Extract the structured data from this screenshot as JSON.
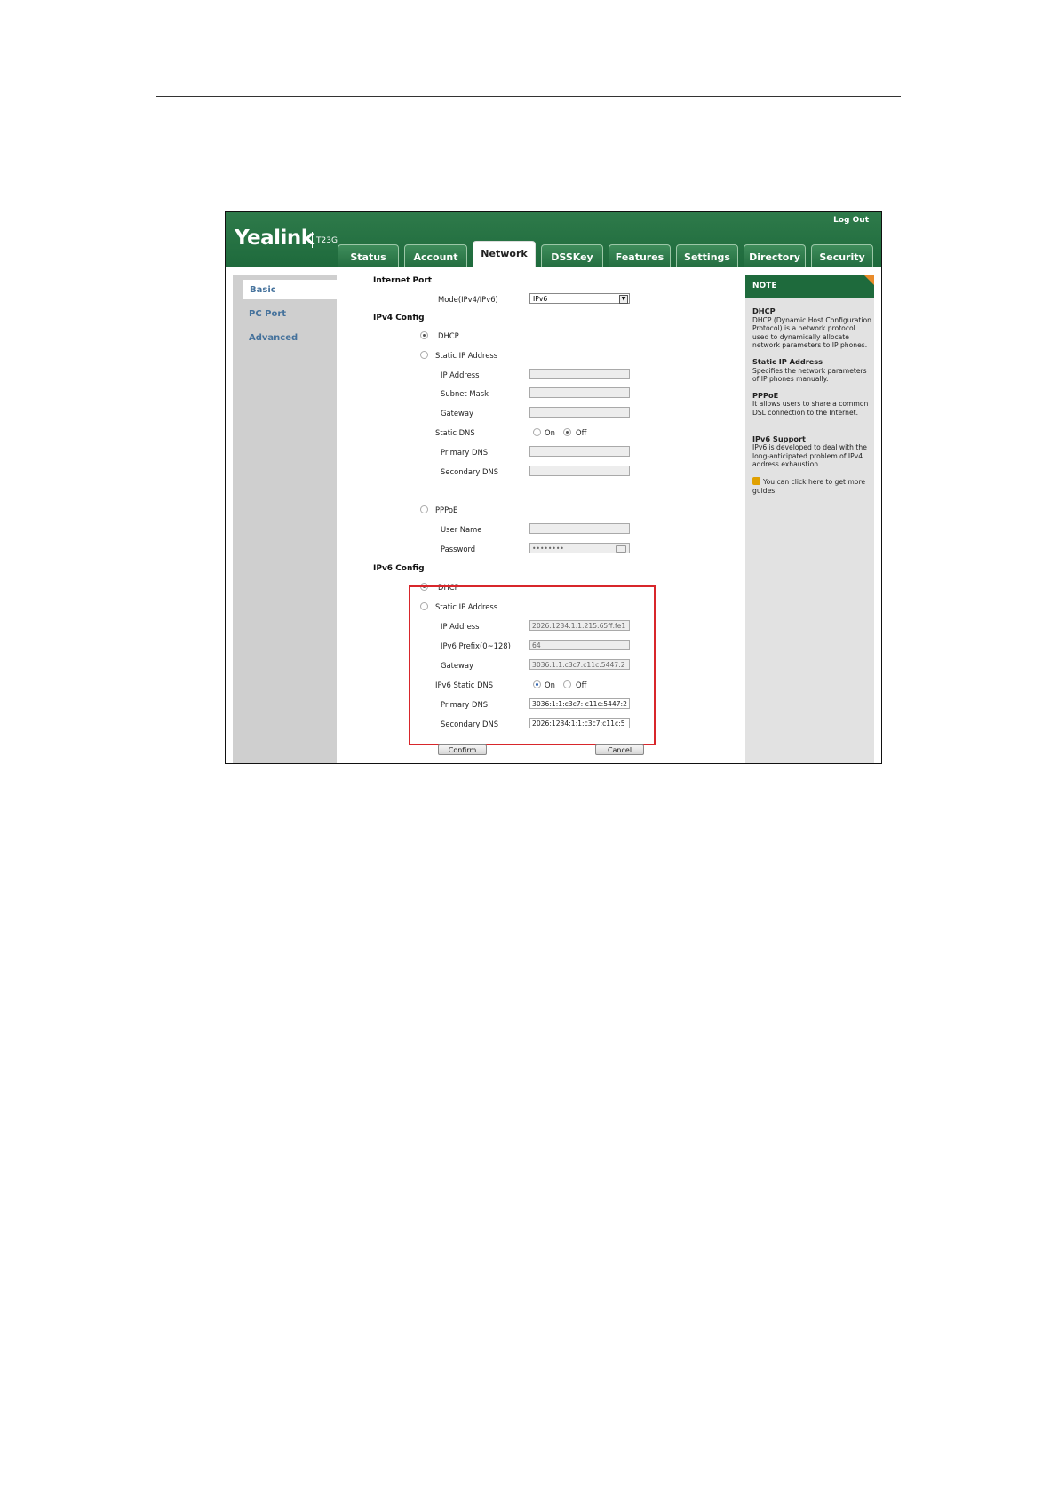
{
  "app": {
    "logo": "Yealink",
    "model": "T23G",
    "logout_label": "Log Out"
  },
  "tabs": [
    {
      "label": "Status"
    },
    {
      "label": "Account"
    },
    {
      "label": "Network",
      "active": true
    },
    {
      "label": "DSSKey"
    },
    {
      "label": "Features"
    },
    {
      "label": "Settings"
    },
    {
      "label": "Directory"
    },
    {
      "label": "Security"
    }
  ],
  "sidebar": {
    "items": [
      {
        "label": "Basic",
        "selected": true
      },
      {
        "label": "PC Port"
      },
      {
        "label": "Advanced"
      }
    ]
  },
  "main": {
    "internet_port_title": "Internet Port",
    "mode_label": "Mode(IPv4/IPv6)",
    "mode_value": "IPv6",
    "ipv4": {
      "title": "IPv4 Config",
      "dhcp_label": "DHCP",
      "static_label": "Static IP Address",
      "ip_label": "IP Address",
      "subnet_label": "Subnet Mask",
      "gateway_label": "Gateway",
      "static_dns_label": "Static DNS",
      "on_label": "On",
      "off_label": "Off",
      "primary_dns_label": "Primary DNS",
      "secondary_dns_label": "Secondary DNS",
      "pppoe_label": "PPPoE",
      "username_label": "User Name",
      "password_label": "Password",
      "password_value": "••••••••"
    },
    "ipv6": {
      "title": "IPv6 Config",
      "dhcp_label": "DHCP",
      "static_label": "Static IP Address",
      "ip_label": "IP Address",
      "ip_value": "2026:1234:1:1:215:65ff:fe1",
      "prefix_label": "IPv6 Prefix(0~128)",
      "prefix_value": "64",
      "gateway_label": "Gateway",
      "gateway_value": "3036:1:1:c3c7:c11c:5447:2",
      "static_dns_label": "IPv6 Static DNS",
      "on_label": "On",
      "off_label": "Off",
      "primary_dns_label": "Primary DNS",
      "primary_dns_value": "3036:1:1:c3c7: c11c:5447:2",
      "secondary_dns_label": "Secondary DNS",
      "secondary_dns_value": "2026:1234:1:1:c3c7:c11c:5"
    },
    "confirm_label": "Confirm",
    "cancel_label": "Cancel"
  },
  "note": {
    "title": "NOTE",
    "sections": [
      {
        "heading": "DHCP",
        "text": "DHCP (Dynamic Host Configuration Protocol) is a network protocol used to dynamically allocate network parameters to IP phones."
      },
      {
        "heading": "Static IP Address",
        "text": "Specifies the network parameters of IP phones manually."
      },
      {
        "heading": "PPPoE",
        "text": "It allows users to share a common DSL connection to the Internet."
      },
      {
        "heading": "IPv6 Support",
        "text": "IPv6 is developed to deal with the long-anticipated problem of IPv4 address exhaustion."
      }
    ],
    "guide_text": "You can click here to get more guides."
  },
  "colors": {
    "header_green": "#1e6a3c",
    "highlight_red": "#d8262b",
    "nav_link_blue": "#45729c",
    "note_corner_orange": "#e98b2a"
  }
}
